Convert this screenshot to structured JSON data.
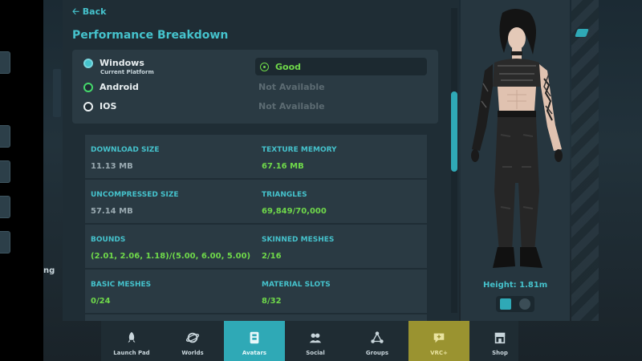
{
  "header": {
    "back_label": "Back",
    "title": "Performance Breakdown"
  },
  "platforms": [
    {
      "name": "Windows",
      "sub": "Current Platform",
      "status": "Good",
      "icon": "windows-icon"
    },
    {
      "name": "Android",
      "sub": "",
      "status": "Not Available",
      "icon": "android-icon"
    },
    {
      "name": "IOS",
      "sub": "",
      "status": "Not Available",
      "icon": "apple-icon"
    }
  ],
  "stats": [
    {
      "label": "DOWNLOAD SIZE",
      "value": "11.13 MB"
    },
    {
      "label": "TEXTURE MEMORY",
      "value": "67.16 MB"
    },
    {
      "label": "UNCOMPRESSED SIZE",
      "value": "57.14 MB"
    },
    {
      "label": "TRIANGLES",
      "value": "69,849/70,000"
    },
    {
      "label": "BOUNDS",
      "value": "(2.01, 2.06, 1.18)/(5.00, 6.00, 5.00)"
    },
    {
      "label": "SKINNED MESHES",
      "value": "2/16"
    },
    {
      "label": "BASIC MESHES",
      "value": "0/24"
    },
    {
      "label": "MATERIAL SLOTS",
      "value": "8/32"
    }
  ],
  "avatar": {
    "height_label": "Height: 1.81m"
  },
  "left_edge_text": "ng",
  "nav": [
    {
      "label": "Launch Pad",
      "icon": "rocket-icon"
    },
    {
      "label": "Worlds",
      "icon": "planet-icon"
    },
    {
      "label": "Avatars",
      "icon": "avatars-icon"
    },
    {
      "label": "Social",
      "icon": "people-icon"
    },
    {
      "label": "Groups",
      "icon": "groups-icon"
    },
    {
      "label": "VRC+",
      "icon": "vrcplus-icon"
    },
    {
      "label": "Shop",
      "icon": "shop-icon"
    }
  ],
  "colors": {
    "accent": "#2fa9b6",
    "good": "#6fd84a",
    "panel": "#1f2d35",
    "vrcplus": "#9a9330"
  }
}
